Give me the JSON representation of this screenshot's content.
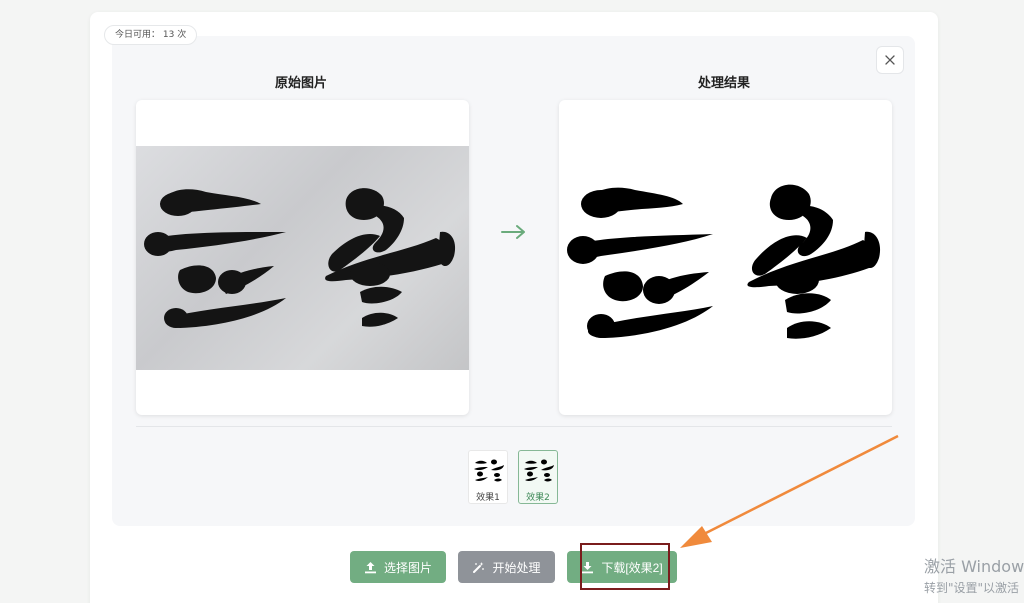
{
  "usage": {
    "label": "今日可用：",
    "count": "13",
    "unit": "次"
  },
  "columns": {
    "original_title": "原始图片",
    "result_title": "处理结果"
  },
  "thumbnails": [
    {
      "label": "效果1",
      "selected": false
    },
    {
      "label": "效果2",
      "selected": true
    }
  ],
  "buttons": {
    "select_label": "选择图片",
    "process_label": "开始处理",
    "download_label": "下载[效果2]"
  },
  "watermark": {
    "line1": "激活 Window",
    "line2": "转到\"设置\"以激活"
  },
  "icons": {
    "close": "close-icon",
    "arrow": "right-arrow-icon",
    "select": "upload-icon",
    "process": "magic-wand-icon",
    "download": "download-icon"
  },
  "colors": {
    "accent_green": "#72ad82",
    "gray_button": "#8f9399",
    "annotation_orange": "#f08a3c",
    "annotation_box": "#7a1c1c"
  }
}
